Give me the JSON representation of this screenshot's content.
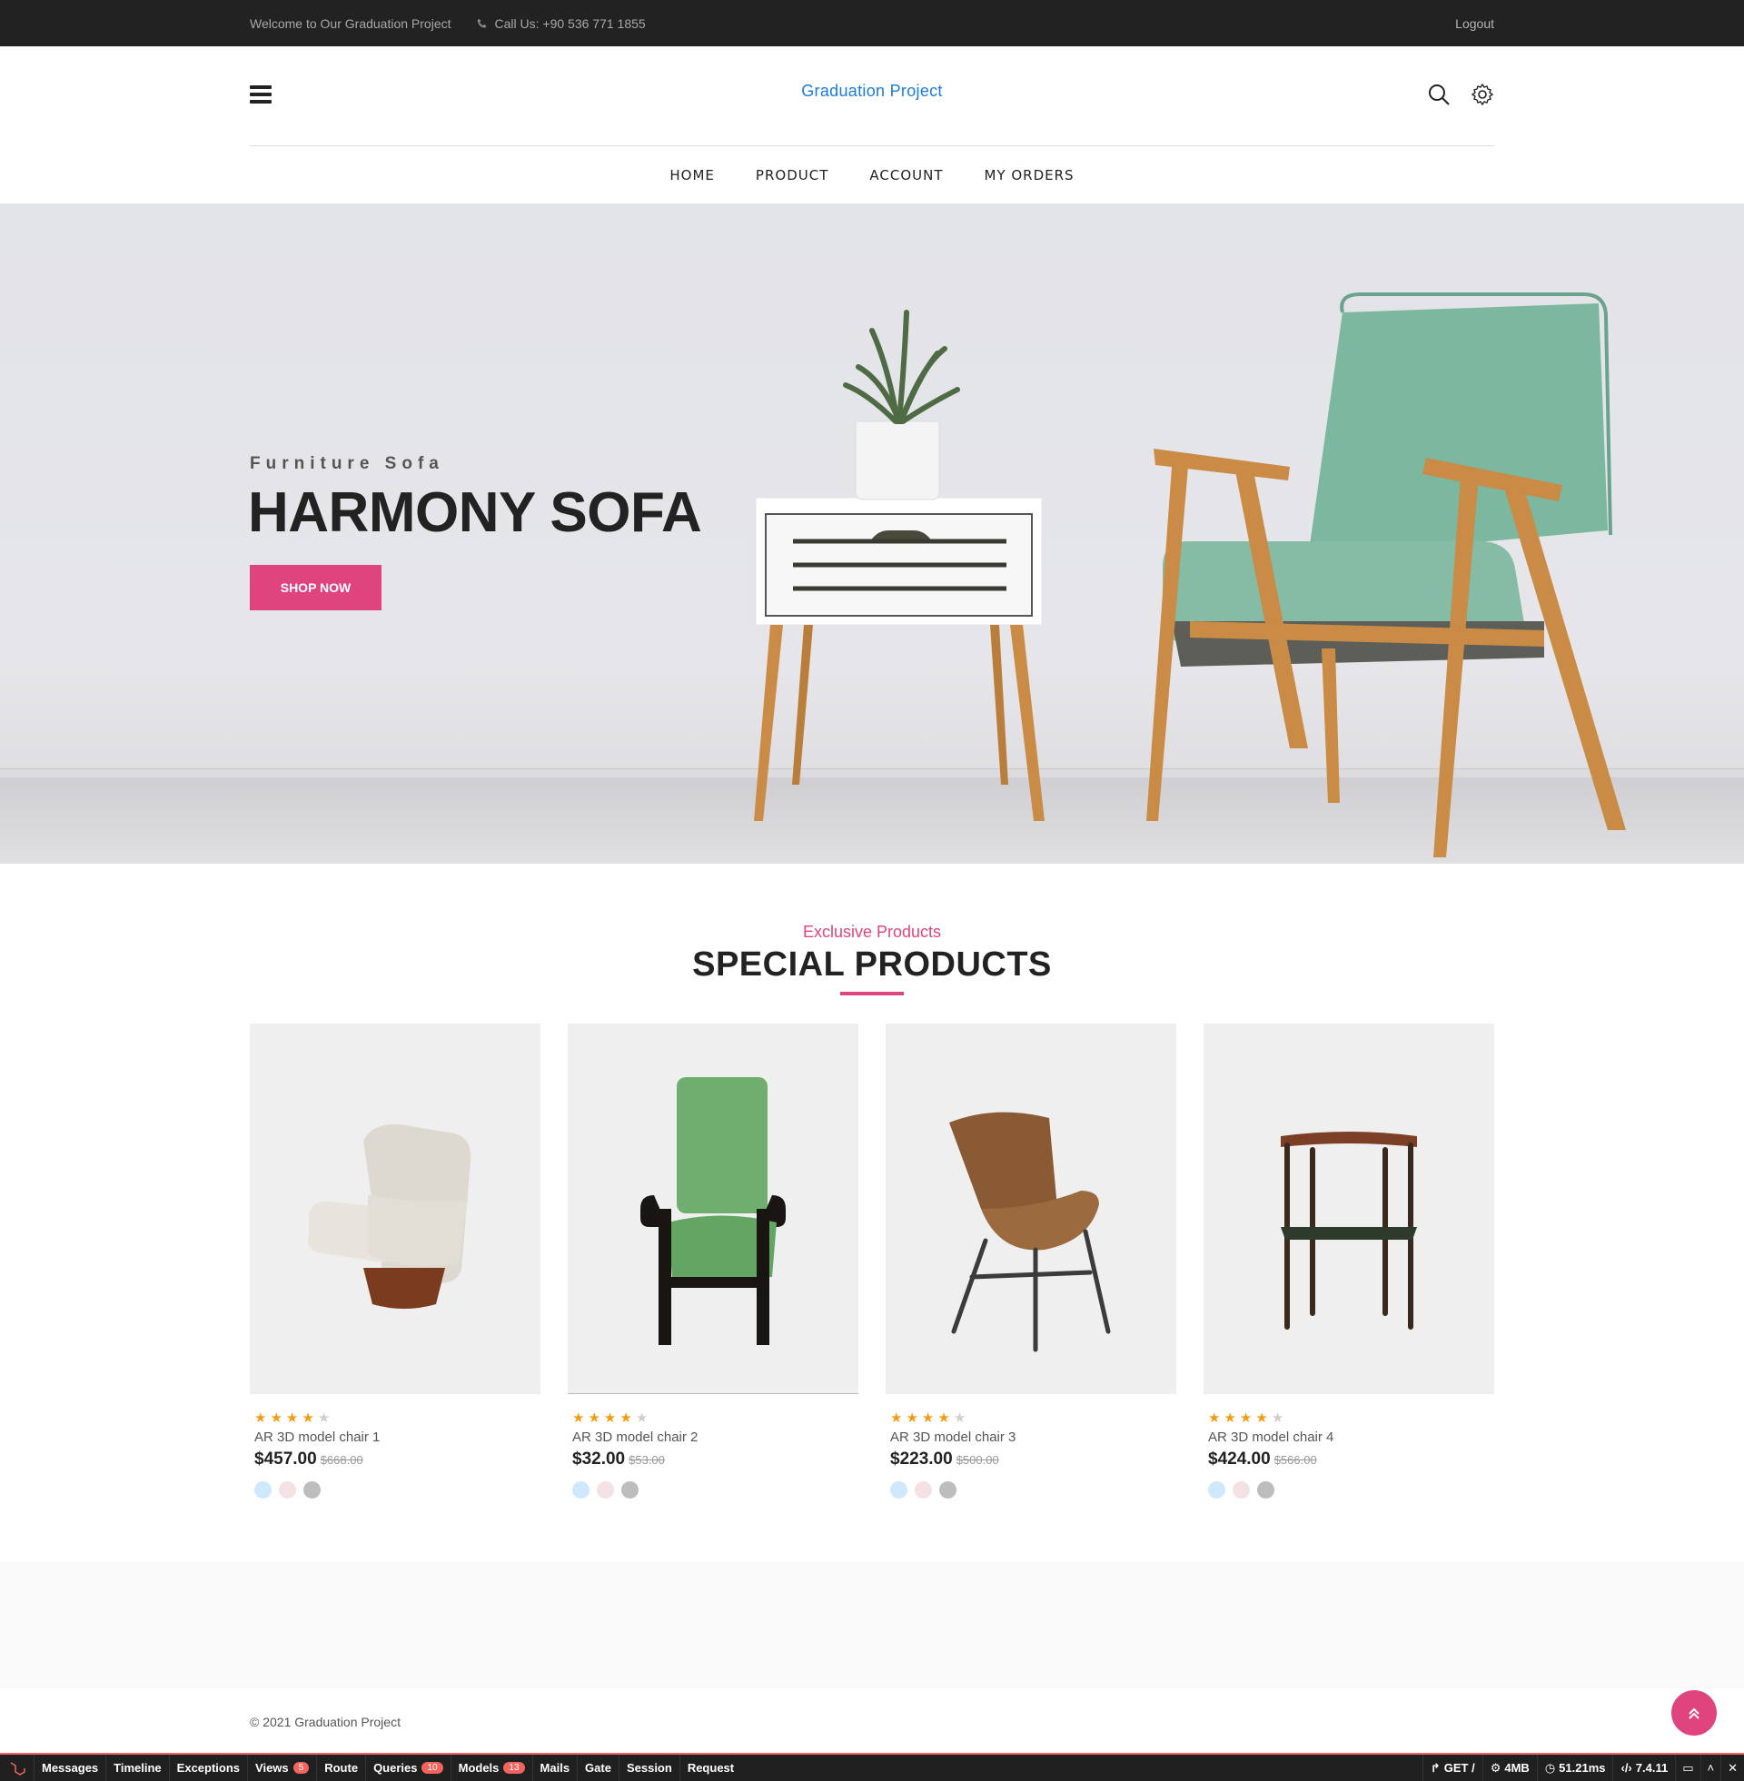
{
  "topbar": {
    "welcome": "Welcome to Our Graduation Project",
    "phone": "Call Us: +90 536 771 1855",
    "logout": "Logout"
  },
  "header": {
    "brand": "Graduation Project",
    "icons": [
      "menu-icon",
      "search-icon",
      "gear-icon"
    ]
  },
  "nav": {
    "items": [
      "HOME",
      "PRODUCT",
      "ACCOUNT",
      "MY ORDERS"
    ]
  },
  "hero": {
    "eyebrow": "Furniture Sofa",
    "title": "HARMONY SOFA",
    "button": "SHOP NOW"
  },
  "section": {
    "subtitle": "Exclusive Products",
    "title": "SPECIAL PRODUCTS"
  },
  "products": [
    {
      "name": "AR 3D model chair 1",
      "price": "$457.00",
      "old_price": "$668.00",
      "rating": 4
    },
    {
      "name": "AR 3D model chair 2",
      "price": "$32.00",
      "old_price": "$53.00",
      "rating": 4
    },
    {
      "name": "AR 3D model chair 3",
      "price": "$223.00",
      "old_price": "$500.00",
      "rating": 4
    },
    {
      "name": "AR 3D model chair 4",
      "price": "$424.00",
      "old_price": "$566.00",
      "rating": 4
    }
  ],
  "swatch_colors": [
    "#cfe8fb",
    "#f3e1e4",
    "#bdbdbd"
  ],
  "footer": {
    "copyright": "© 2021 Graduation Project"
  },
  "debugbar": {
    "tabs": [
      {
        "label": "Messages",
        "badge": ""
      },
      {
        "label": "Timeline",
        "badge": ""
      },
      {
        "label": "Exceptions",
        "badge": ""
      },
      {
        "label": "Views",
        "badge": "5"
      },
      {
        "label": "Route",
        "badge": ""
      },
      {
        "label": "Queries",
        "badge": "10"
      },
      {
        "label": "Models",
        "badge": "13"
      },
      {
        "label": "Mails",
        "badge": ""
      },
      {
        "label": "Gate",
        "badge": ""
      },
      {
        "label": "Session",
        "badge": ""
      },
      {
        "label": "Request",
        "badge": ""
      }
    ],
    "method": "GET /",
    "memory": "4MB",
    "time": "51.21ms",
    "version": "7.4.11"
  },
  "colors": {
    "accent": "#e0447f",
    "brand": "#1a7be0",
    "topbar": "#222222",
    "star": "#f39c12"
  }
}
